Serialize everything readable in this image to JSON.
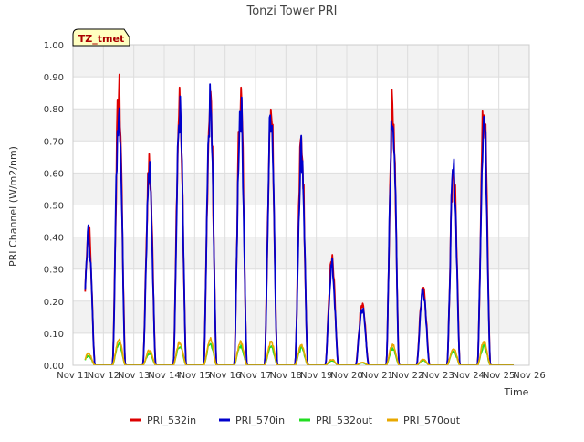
{
  "chart_data": {
    "type": "line",
    "title": "Tonzi Tower PRI",
    "xlabel": "Time",
    "ylabel": "PRI Channel (W/m2/nm)",
    "annotation": "TZ_tmet",
    "ylim": [
      0.0,
      1.0
    ],
    "xlim": [
      11,
      26
    ],
    "yticks": [
      "0.00",
      "0.10",
      "0.20",
      "0.30",
      "0.40",
      "0.50",
      "0.60",
      "0.70",
      "0.80",
      "0.90",
      "1.00"
    ],
    "xticks": [
      {
        "v": 11,
        "label": "Nov 11"
      },
      {
        "v": 12,
        "label": "Nov 12"
      },
      {
        "v": 13,
        "label": "Nov 13"
      },
      {
        "v": 14,
        "label": "Nov 14"
      },
      {
        "v": 15,
        "label": "Nov 15"
      },
      {
        "v": 16,
        "label": "Nov 16"
      },
      {
        "v": 17,
        "label": "Nov 17"
      },
      {
        "v": 18,
        "label": "Nov 18"
      },
      {
        "v": 19,
        "label": "Nov 19"
      },
      {
        "v": 20,
        "label": "Nov 20"
      },
      {
        "v": 21,
        "label": "Nov 21"
      },
      {
        "v": 22,
        "label": "Nov 22"
      },
      {
        "v": 23,
        "label": "Nov 23"
      },
      {
        "v": 24,
        "label": "Nov 24"
      },
      {
        "v": 25,
        "label": "Nov 25"
      },
      {
        "v": 26,
        "label": "Nov 26"
      }
    ],
    "grid": true,
    "legend_position": "bottom",
    "x_range_data": [
      11.4,
      25.5
    ],
    "days": [
      {
        "day": 11,
        "peak_in": 0.46,
        "peak_out": 0.04
      },
      {
        "day": 12,
        "peak_in": 0.92,
        "peak_out": 0.09
      },
      {
        "day": 13,
        "peak_in": 0.67,
        "peak_out": 0.05
      },
      {
        "day": 14,
        "peak_in": 0.89,
        "peak_out": 0.08
      },
      {
        "day": 15,
        "peak_in": 0.91,
        "peak_out": 0.09
      },
      {
        "day": 16,
        "peak_in": 0.92,
        "peak_out": 0.08
      },
      {
        "day": 17,
        "peak_in": 0.9,
        "peak_out": 0.08
      },
      {
        "day": 18,
        "peak_in": 0.76,
        "peak_out": 0.07
      },
      {
        "day": 19,
        "peak_in": 0.35,
        "peak_out": 0.02
      },
      {
        "day": 20,
        "peak_in": 0.2,
        "peak_out": 0.01
      },
      {
        "day": 21,
        "peak_in": 0.89,
        "peak_out": 0.07
      },
      {
        "day": 22,
        "peak_in": 0.27,
        "peak_out": 0.02
      },
      {
        "day": 23,
        "peak_in": 0.68,
        "peak_out": 0.06
      },
      {
        "day": 24,
        "peak_in": 0.88,
        "peak_out": 0.08
      }
    ],
    "series": [
      {
        "name": "PRI_532in",
        "color": "#dd0000",
        "kind": "in",
        "scale": 1.0,
        "offset": 0.004
      },
      {
        "name": "PRI_570in",
        "color": "#0000cc",
        "kind": "in",
        "scale": 0.97,
        "offset": 0.0
      },
      {
        "name": "PRI_532out",
        "color": "#22dd22",
        "kind": "out",
        "scale": 0.82,
        "offset": 0.0
      },
      {
        "name": "PRI_570out",
        "color": "#e8a800",
        "kind": "out",
        "scale": 1.0,
        "offset": 0.0
      }
    ]
  }
}
